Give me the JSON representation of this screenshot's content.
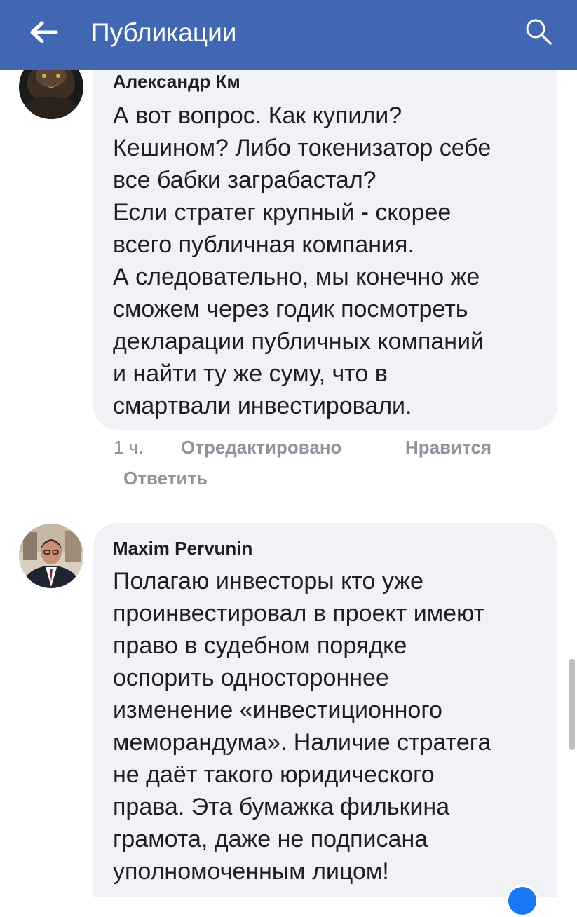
{
  "header": {
    "title": "Публикации",
    "back_icon": "arrow-left-icon",
    "search_icon": "search-icon",
    "background": "#4267b2"
  },
  "comments": [
    {
      "author": "Александр Км",
      "text": "А вот вопрос. Как купили?\nКешином? Либо токенизатор себе\nвсе бабки заграбастал?\nЕсли стратег крупный - скорее\nвсего публичная компания.\nА следовательно, мы конечно же\nсможем через годик посмотреть\nдекларации публичных компаний\nи найти ту же суму, что в\nсмартвали инвестировали.",
      "time": "1 ч.",
      "edited": "Отредактировано",
      "like": "Нравится",
      "reply": "Ответить"
    },
    {
      "author": "Maxim Pervunin",
      "text": "Полагаю инвесторы кто уже\nпроинвестировал в проект имеют\nправо в судебном порядке\nоспорить одностороннее\nизменение «инвестиционного\nмеморандума». Наличие стратега\nне даёт такого юридического\nправа. Эта бумажка филькина\nграмота, даже не подписана\nуполномоченным лицом!"
    }
  ]
}
